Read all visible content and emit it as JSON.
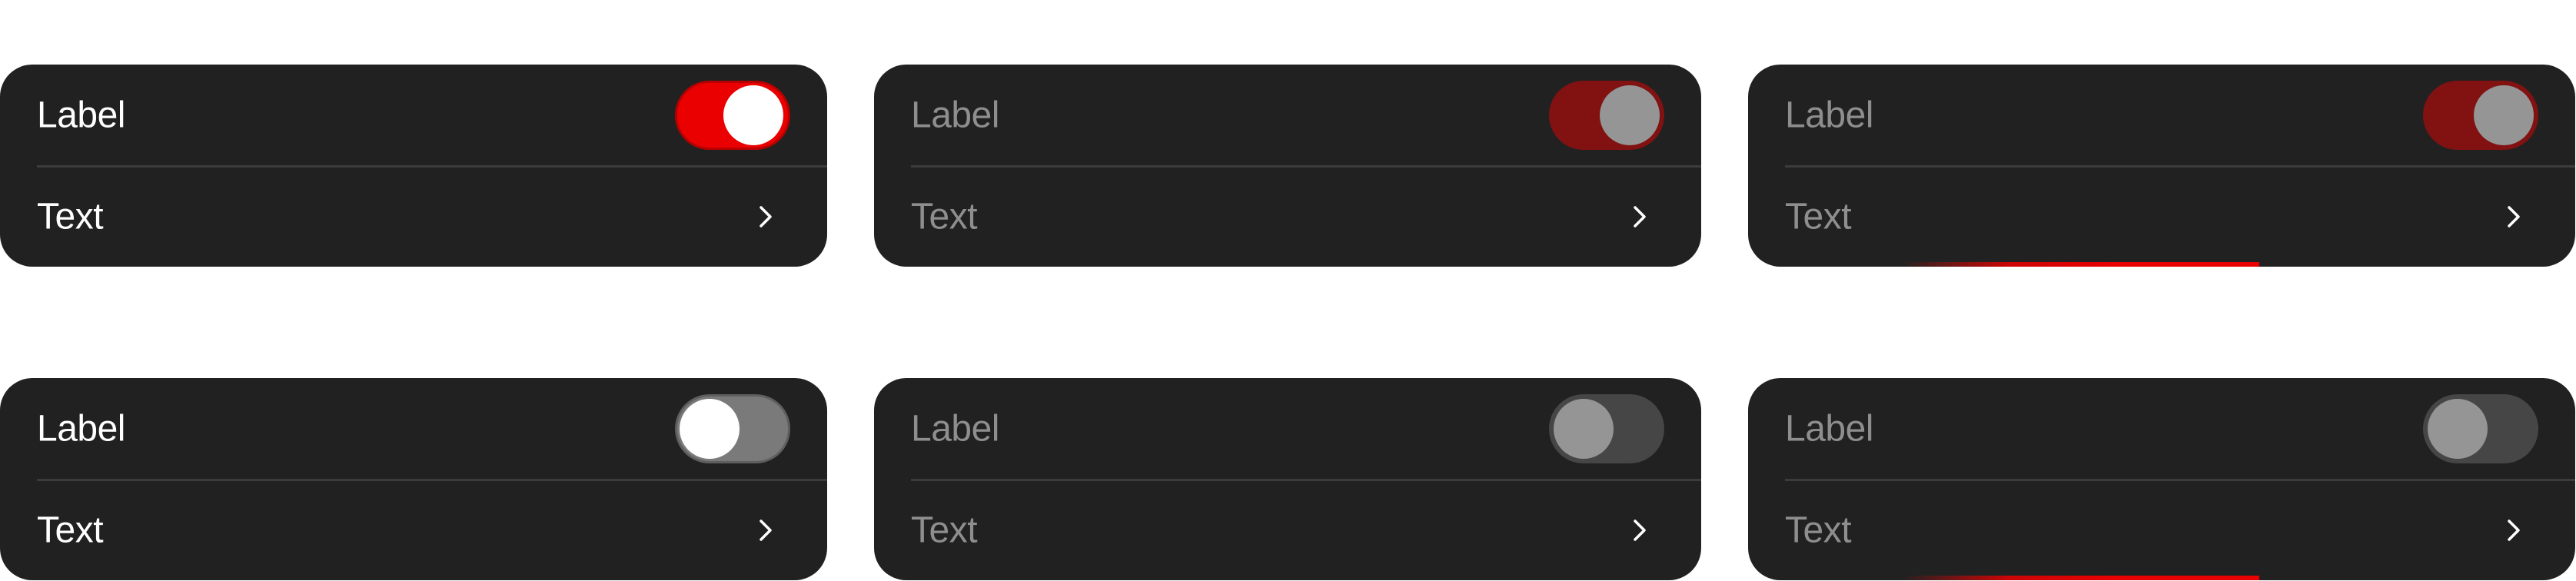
{
  "cards": [
    {
      "toggle_label": "Label",
      "toggle_state": "on",
      "row_text": "Text",
      "state": "enabled"
    },
    {
      "toggle_label": "Label",
      "toggle_state": "on",
      "row_text": "Text",
      "state": "disabled"
    },
    {
      "toggle_label": "Label",
      "toggle_state": "on",
      "row_text": "Text",
      "state": "disabled-focused"
    },
    {
      "toggle_label": "Label",
      "toggle_state": "off",
      "row_text": "Text",
      "state": "enabled"
    },
    {
      "toggle_label": "Label",
      "toggle_state": "off",
      "row_text": "Text",
      "state": "disabled"
    },
    {
      "toggle_label": "Label",
      "toggle_state": "off",
      "row_text": "Text",
      "state": "disabled-focused"
    }
  ],
  "icons": {
    "row_chevron": "chevron-right-icon"
  },
  "colors": {
    "card_background": "#212121",
    "accent_red": "#ea0000",
    "text_enabled": "#ffffff",
    "text_disabled": "#8e8e8e"
  }
}
